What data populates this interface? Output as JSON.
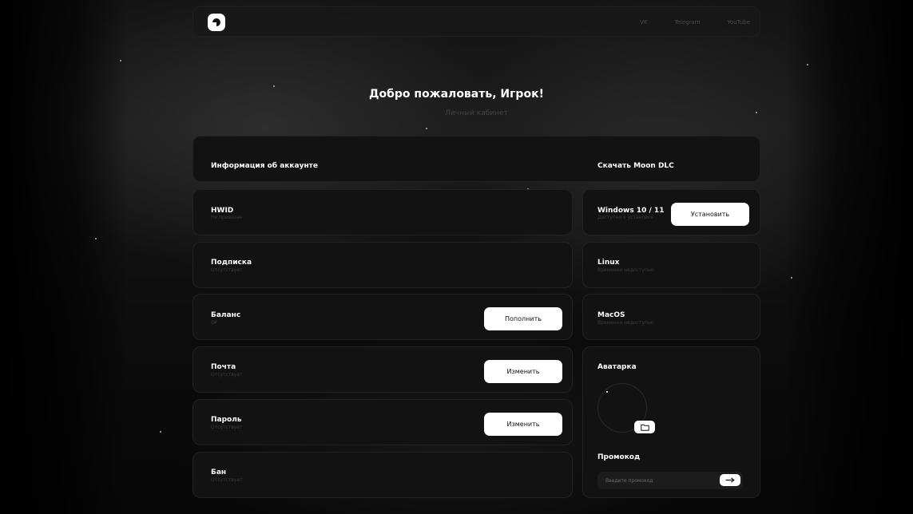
{
  "nav": {
    "links": [
      "VK",
      "Telegram",
      "YouTube"
    ]
  },
  "hero": {
    "title": "Добро пожаловать, Игрок!",
    "subtitle": "Личный кабинет"
  },
  "account": {
    "title": "Информация об аккаунте",
    "items": [
      {
        "title": "HWID",
        "status": "Не привязан"
      },
      {
        "title": "Подписка",
        "status": "Отсутствует"
      },
      {
        "title": "Баланс",
        "status": "0₽",
        "button": "Пополнить"
      },
      {
        "title": "Почта",
        "status": "Отсутствует",
        "button": "Изменить"
      },
      {
        "title": "Пароль",
        "status": "Отсутствует",
        "button": "Изменить"
      },
      {
        "title": "Бан",
        "status": "Отсутствует"
      }
    ]
  },
  "download": {
    "title": "Скачать Moon DLC",
    "items": [
      {
        "title": "Windows 10 / 11",
        "status": "Доступно к установке",
        "button": "Установить"
      },
      {
        "title": "Linux",
        "status": "Временно недоступно"
      },
      {
        "title": "MacOS",
        "status": "Временно недоступно"
      }
    ]
  },
  "avatar": {
    "title": "Аватарка",
    "icon": "folder-icon"
  },
  "promo": {
    "title": "Промокод",
    "placeholder": "Введите промокод",
    "submit_icon": "arrow-right-icon"
  }
}
